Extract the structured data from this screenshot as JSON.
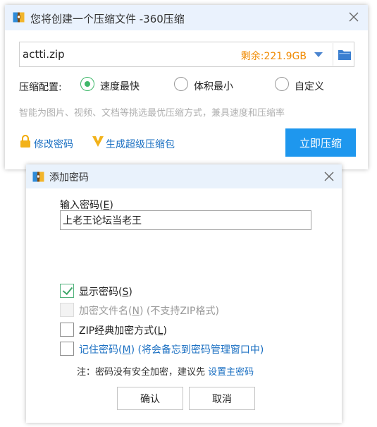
{
  "main_window": {
    "title": "您将创建一个压缩文件 -360压缩",
    "file_name": "actti.zip",
    "free_space": "剩余:221.9GB",
    "config_label": "压缩配置:",
    "radio_options": [
      {
        "label": "速度最快",
        "selected": true
      },
      {
        "label": "体积最小",
        "selected": false
      },
      {
        "label": "自定义",
        "selected": false
      }
    ],
    "hint": "智能为图片、视频、文档等挑选最优压缩方式，兼具速度和压缩率",
    "links": {
      "change_password": "修改密码",
      "super_package": "生成超级压缩包"
    },
    "compress_button": "立即压缩"
  },
  "password_dialog": {
    "title": "添加密码",
    "input_label": "输入密码(",
    "input_label_key": "E",
    "input_label_end": ")",
    "password_value": "上老王论坛当老王",
    "checkboxes": [
      {
        "label": "显示密码(",
        "key": "S",
        "suffix": ")",
        "checked": true,
        "enabled": true
      },
      {
        "label": "加密文件名(",
        "key": "N",
        "suffix": ") (不支持ZIP格式)",
        "checked": false,
        "enabled": false
      },
      {
        "label": "ZIP经典加密方式(",
        "key": "L",
        "suffix": ")",
        "checked": false,
        "enabled": true
      },
      {
        "label": "记住密码(",
        "key": "M",
        "suffix": ") (将会备忘到密码管理窗口中)",
        "checked": false,
        "enabled": true
      }
    ],
    "note_text": "注：密码没有安全加密，建议先 ",
    "note_link": "设置主密码",
    "ok_button": "确认",
    "cancel_button": "取消"
  },
  "colors": {
    "title_bar": "#eaf2fd",
    "accent_blue": "#1e97ee",
    "link_blue": "#1a6fc2",
    "free_space_orange": "#f08a00",
    "radio_green": "#3fb86a"
  },
  "icons": [
    "archive-app-icon",
    "close-icon",
    "chevron-down-icon",
    "folder-icon",
    "lock-icon",
    "v-badge-icon",
    "check-icon"
  ]
}
